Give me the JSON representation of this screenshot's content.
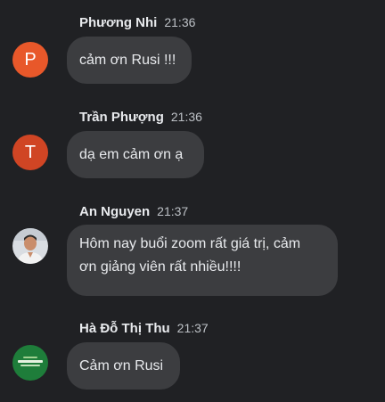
{
  "messages": [
    {
      "author": "Phương Nhi",
      "time": "21:36",
      "avatar_letter": "P",
      "text": "cảm ơn Rusi !!!"
    },
    {
      "author": "Trần Phượng",
      "time": "21:36",
      "avatar_letter": "T",
      "text": "dạ em cảm ơn ạ"
    },
    {
      "author": "An Nguyen",
      "time": "21:37",
      "avatar_icon": "person-photo-avatar",
      "text_line1": "Hôm nay buổi zoom rất giá trị, cảm",
      "text_line2": "ơn giảng viên rất nhiều!!!!"
    },
    {
      "author": "Hà Đỗ Thị Thu",
      "time": "21:37",
      "avatar_icon": "green-logo-avatar",
      "text": "Cảm ơn Rusi"
    }
  ],
  "colors": {
    "background": "#202124",
    "bubble": "#3c3d40",
    "avatar_orange": "#e8582a",
    "avatar_red": "#d04524",
    "avatar_green": "#1e7d3a"
  }
}
